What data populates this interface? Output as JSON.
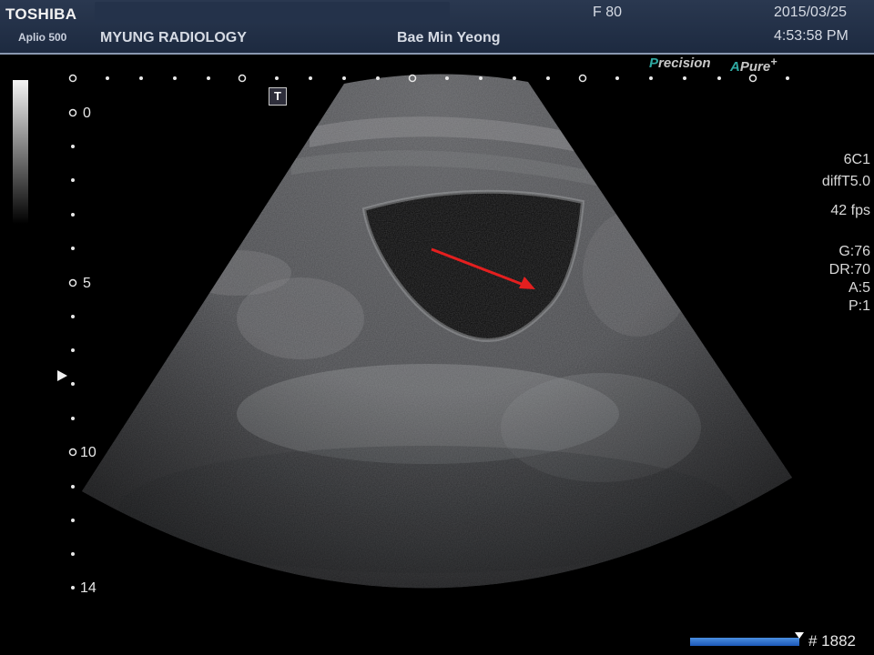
{
  "header": {
    "brand": "TOSHIBA",
    "model": "Aplio 500",
    "hospital": "MYUNG RADIOLOGY",
    "patient": "Bae Min Yeong",
    "frame_rate_label": "F  80",
    "date": "2015/03/25",
    "time": "4:53:58 PM"
  },
  "modes": {
    "precision_acc": "P",
    "precision_rest": "recision",
    "apure_acc": "A",
    "apure_rest": "Pure",
    "apure_plus": "+"
  },
  "annotation": {
    "t_marker": "T",
    "arrow_color": "#e41f1f"
  },
  "depth_scale": {
    "labels": [
      "0",
      "5",
      "10",
      "14"
    ]
  },
  "params": {
    "probe": "6C1",
    "mode": "diffT5.0",
    "fps": "42 fps",
    "gain": "G:76",
    "dynamic_range": "DR:70",
    "a": "A:5",
    "p": "P:1"
  },
  "footer": {
    "frame_count": "# 1882"
  },
  "colors": {
    "header_bg": "#1d2a40",
    "accent_teal": "#2fa9a2",
    "progress_blue": "#2a6fd0"
  }
}
